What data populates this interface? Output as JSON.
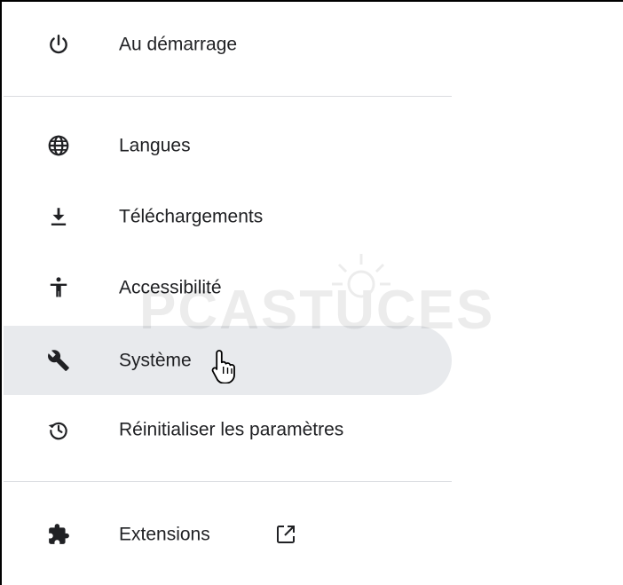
{
  "menu": {
    "items": [
      {
        "label": "Au démarrage",
        "icon": "power-icon"
      },
      {
        "label": "Langues",
        "icon": "globe-icon"
      },
      {
        "label": "Téléchargements",
        "icon": "download-icon"
      },
      {
        "label": "Accessibilité",
        "icon": "accessibility-icon"
      },
      {
        "label": "Système",
        "icon": "wrench-icon",
        "active": true
      },
      {
        "label": "Réinitialiser les paramètres",
        "icon": "restore-icon"
      },
      {
        "label": "Extensions",
        "icon": "puzzle-icon",
        "external_link_icon": "open-in-new-icon"
      }
    ]
  },
  "watermark": {
    "text": "PCASTUCES"
  },
  "colors": {
    "active_background": "#e8eaed",
    "icon": "#5f6368",
    "text": "#202124",
    "divider": "#dadce0"
  }
}
